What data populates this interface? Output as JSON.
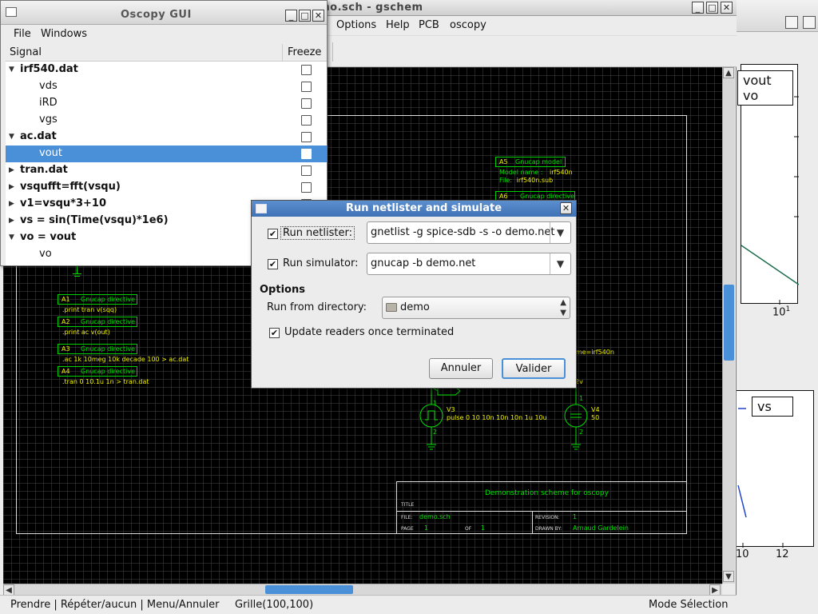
{
  "plot_window": {
    "legend_top": [
      "vout",
      "vo"
    ],
    "tick_10": "10",
    "tick_10_exp": "1",
    "legend_bottom": "vs",
    "bottom_ticks": [
      "10",
      "12"
    ],
    "line_color": "#1a6b4a",
    "series_color": "#2244cc"
  },
  "gschem": {
    "title": "demo.sch - gschem",
    "menu": [
      "Options",
      "Help",
      "PCB",
      "oscopy"
    ],
    "status": {
      "left": "Prendre | Répéter/aucun | Menu/Annuler",
      "grid": "Grille(100,100)",
      "mode": "Mode Sélection"
    },
    "schematic": {
      "directives": [
        {
          "ref": "A1",
          "kind": "Gnucap directive",
          "text": ".print tran v(sqq)"
        },
        {
          "ref": "A2",
          "kind": "Gnucap directive",
          "text": ".print ac v(out)"
        },
        {
          "ref": "A3",
          "kind": "Gnucap directive",
          "text": ".ac 1k 10meg 10k decade 100 > ac.dat"
        },
        {
          "ref": "A4",
          "kind": "Gnucap directive",
          "text": ".tran 0 10.1u 1n > tran.dat"
        }
      ],
      "model": {
        "ref": "A5",
        "kind": "Gnucap model",
        "name_label": "Model name :",
        "name": "irf540n",
        "file_label": "File:",
        "file": "irf540n.sub"
      },
      "directive_a6": {
        "ref": "A6",
        "kind": "Gnucap directive"
      },
      "partial_text": "-name=irf540n",
      "v3": {
        "ref": "V3",
        "value": "pulse 0 10 10n 10n 10n 1u 10u",
        "pin1": "1",
        "pin2": "2"
      },
      "v4": {
        "ref": "V4",
        "value": "50",
        "pin1": "1",
        "pin2": "2",
        "net": "2v"
      },
      "title_block": {
        "heading": "Demonstration scheme for oscopy",
        "title_label": "TITLE",
        "file_label": "FILE:",
        "file": "demo.sch",
        "page_label": "PAGE",
        "page": "1",
        "of_label": "OF",
        "of": "1",
        "revision_label": "REVISION:",
        "revision": "1",
        "drawn_label": "DRAWN BY:",
        "drawn_by": "Arnaud Gardelein"
      }
    }
  },
  "oscopy": {
    "title": "Oscopy GUI",
    "menu": [
      "File",
      "Windows"
    ],
    "columns": {
      "signal": "Signal",
      "freeze": "Freeze"
    },
    "rows": [
      {
        "label": "irf540.dat",
        "level": 0,
        "expander": "▼",
        "bold": true
      },
      {
        "label": "vds",
        "level": 1,
        "expander": "",
        "bold": false
      },
      {
        "label": "iRD",
        "level": 1,
        "expander": "",
        "bold": false
      },
      {
        "label": "vgs",
        "level": 1,
        "expander": "",
        "bold": false
      },
      {
        "label": "ac.dat",
        "level": 0,
        "expander": "▼",
        "bold": true
      },
      {
        "label": "vout",
        "level": 1,
        "expander": "",
        "bold": false,
        "selected": true
      },
      {
        "label": "tran.dat",
        "level": 0,
        "expander": "▶",
        "bold": true
      },
      {
        "label": "vsqufft=fft(vsqu)",
        "level": 0,
        "expander": "▶",
        "bold": true
      },
      {
        "label": "v1=vsqu*3+10",
        "level": 0,
        "expander": "▶",
        "bold": true
      },
      {
        "label": "vs = sin(Time(vsqu)*1e6)",
        "level": 0,
        "expander": "▶",
        "bold": true
      },
      {
        "label": "vo = vout",
        "level": 0,
        "expander": "▼",
        "bold": true
      },
      {
        "label": "vo",
        "level": 1,
        "expander": "",
        "bold": false
      }
    ]
  },
  "dialog": {
    "title": "Run netlister and simulate",
    "run_netlister_label": "Run netlister:",
    "run_netlister_checked": true,
    "netlister_cmd": "gnetlist -g spice-sdb -s -o demo.net",
    "run_simulator_label": "Run simulator:",
    "run_simulator_checked": true,
    "simulator_cmd": "gnucap -b demo.net",
    "options_heading": "Options",
    "run_from_label": "Run from directory:",
    "directory": "demo",
    "update_readers_label": "Update readers once terminated",
    "update_readers_checked": true,
    "cancel_label": "Annuler",
    "ok_label": "Valider",
    "accent": "#4a90d9"
  }
}
